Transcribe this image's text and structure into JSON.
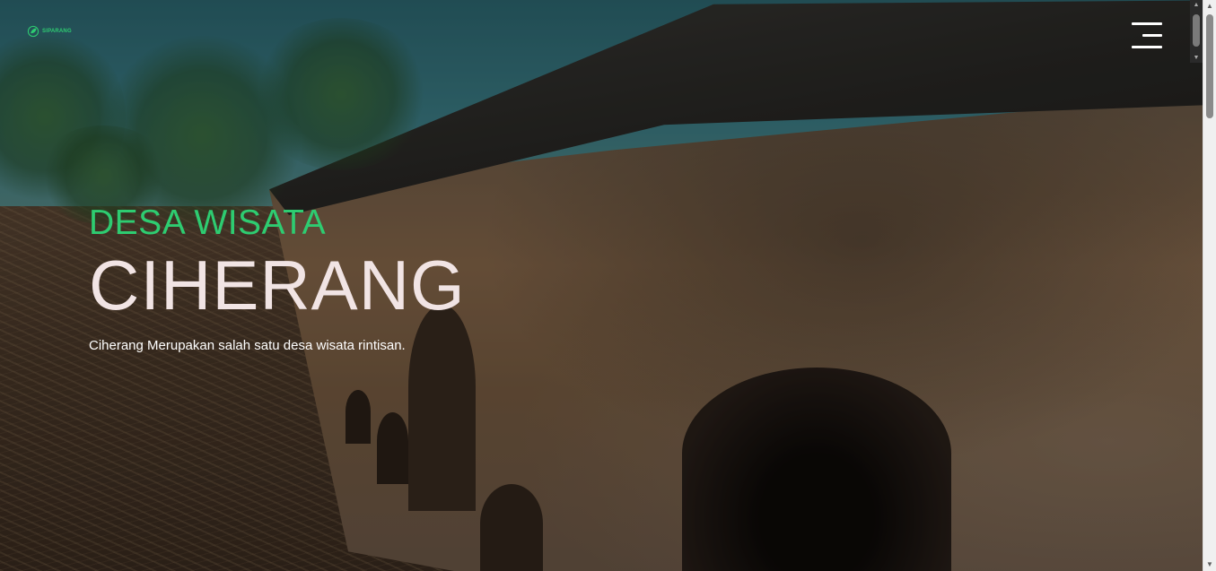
{
  "header": {
    "logo_text": "SIPARANG",
    "logo_icon": "leaf-icon",
    "menu_icon": "hamburger-menu-icon"
  },
  "hero": {
    "kicker": "DESA WISATA",
    "title": "CIHERANG",
    "description": "Ciherang Merupakan salah satu desa wisata rintisan.",
    "background": "stone-wall-with-arches-photo"
  },
  "colors": {
    "accent": "#2ecc71",
    "title": "#f1e4e4",
    "text": "#ffffff"
  }
}
